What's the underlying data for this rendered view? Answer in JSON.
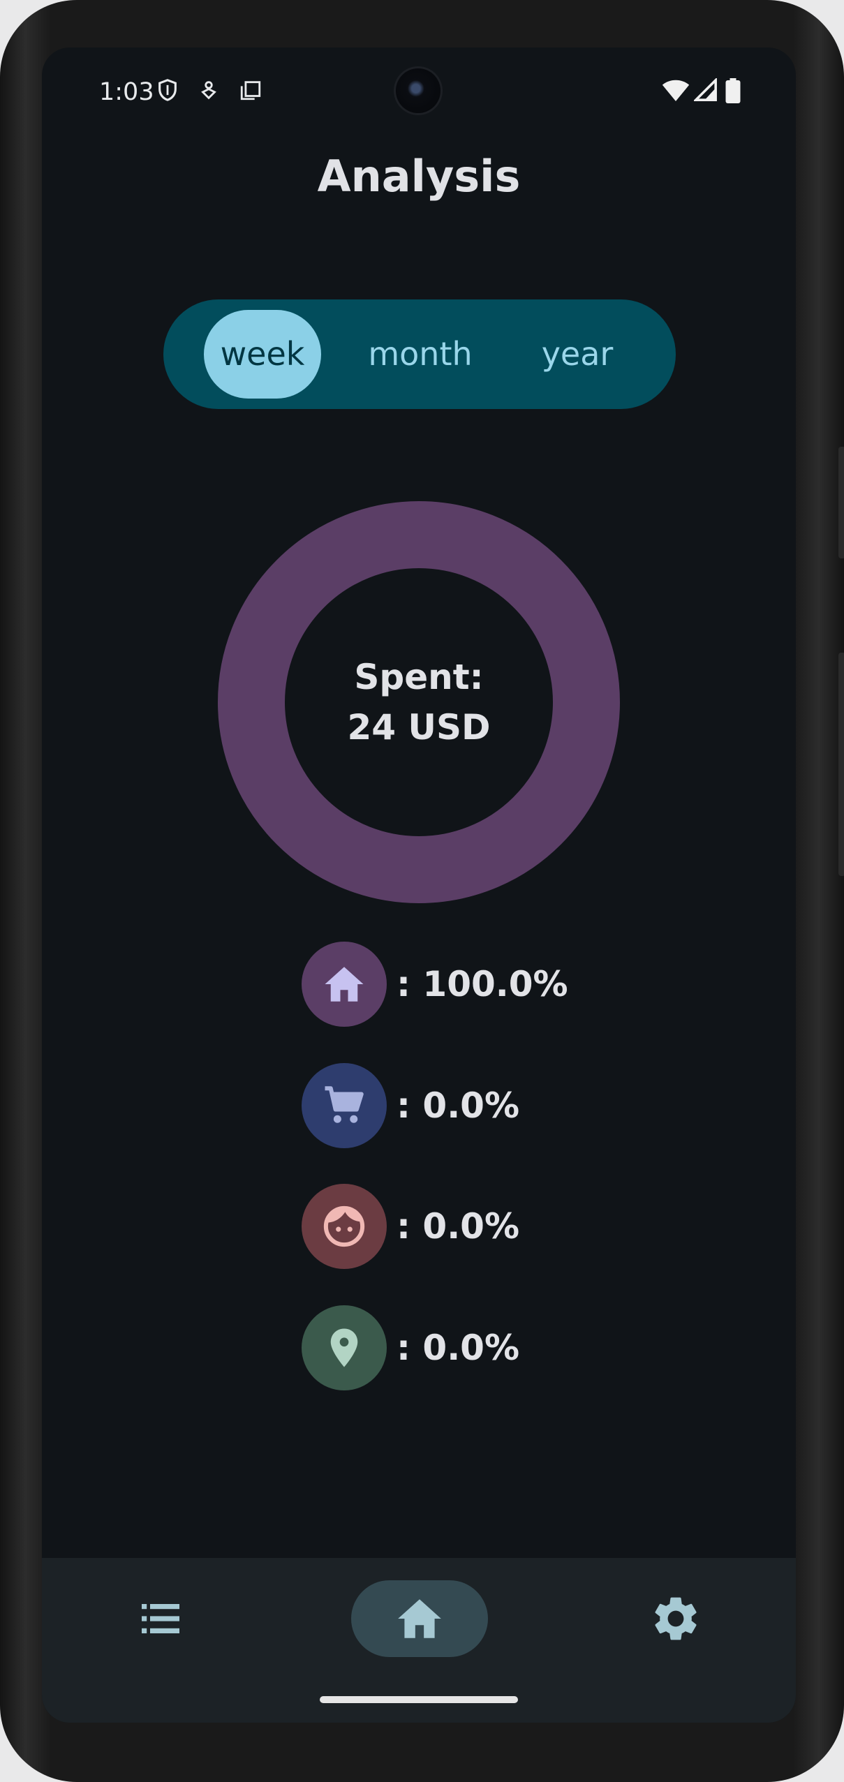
{
  "status_bar": {
    "time": "1:03",
    "icons": [
      "shield-icon",
      "wallet-sync-icon",
      "screen-copy-icon",
      "wifi-icon",
      "signal-icon",
      "battery-icon"
    ]
  },
  "page": {
    "title": "Analysis"
  },
  "period_tabs": [
    {
      "label": "week",
      "selected": true
    },
    {
      "label": "month",
      "selected": false
    },
    {
      "label": "year",
      "selected": false
    }
  ],
  "summary": {
    "spent_label": "Spent:",
    "spent_amount": "24 USD"
  },
  "chart_data": {
    "type": "pie",
    "categories": [
      "home",
      "shopping",
      "personal",
      "location"
    ],
    "values": [
      100.0,
      0.0,
      0.0,
      0.0
    ],
    "colors": [
      "#5b3e66",
      "#2e3d6e",
      "#6b3c42",
      "#3b5a4c"
    ]
  },
  "categories": [
    {
      "icon": "house-icon",
      "value": ": 100.0%",
      "bg": "#5b3e66",
      "fg": "#c7c2f0"
    },
    {
      "icon": "shopping-cart-icon",
      "value": ": 0.0%",
      "bg": "#2e3d6e",
      "fg": "#a9b3de"
    },
    {
      "icon": "face-icon",
      "value": ": 0.0%",
      "bg": "#6b3c42",
      "fg": "#f0b8b4"
    },
    {
      "icon": "location-pin-icon",
      "value": ": 0.0%",
      "bg": "#3b5a4c",
      "fg": "#b2d4c4"
    }
  ],
  "bottom_nav": [
    {
      "icon": "list-icon",
      "selected": false
    },
    {
      "icon": "home-icon",
      "selected": true
    },
    {
      "icon": "gear-icon",
      "selected": false
    }
  ]
}
